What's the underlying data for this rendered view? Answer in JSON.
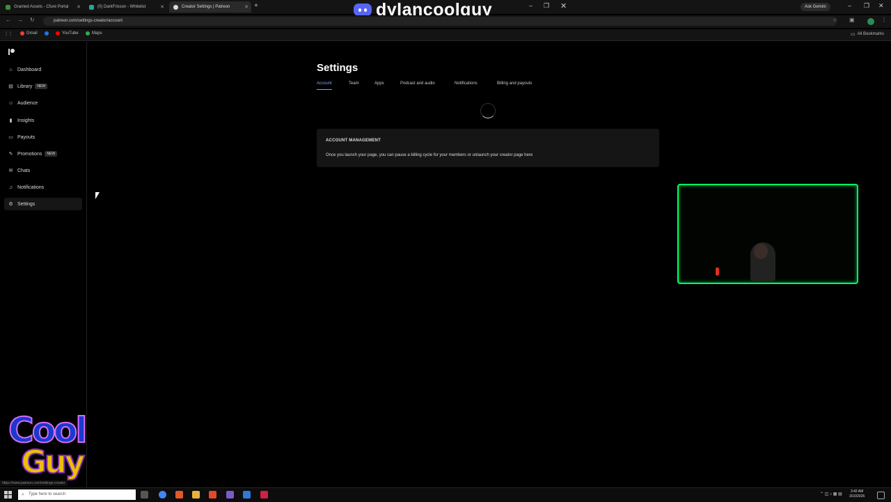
{
  "browser": {
    "tabs": [
      {
        "title": "Granted Assets - Cfure Portal",
        "color": "#3a8f3a"
      },
      {
        "title": "(0) DarkFrisson - Whitelist",
        "color": "#2aa39b"
      },
      {
        "title": "Creator Settings | Patreon",
        "color": "#dddddd"
      }
    ],
    "url": "patreon.com/settings-creator/account",
    "ask_gemini": "Ask Gemini",
    "bookmarks": [
      {
        "label": "Gmail",
        "color": "#ea4335"
      },
      {
        "label": "YouTube",
        "color": "#ff0000"
      },
      {
        "label": "Maps",
        "color": "#34a853"
      }
    ],
    "all_bookmarks": "All Bookmarks"
  },
  "overlay": {
    "discord_name": "dylancoolguy_",
    "logo_top": "Cool",
    "logo_bottom": "Guy"
  },
  "sidebar": {
    "items": [
      {
        "label": "Dashboard",
        "icon": "home-icon",
        "glyph": "⌂"
      },
      {
        "label": "Library",
        "icon": "library-icon",
        "glyph": "▤",
        "badge": "NEW"
      },
      {
        "label": "Audience",
        "icon": "audience-icon",
        "glyph": "☺"
      },
      {
        "label": "Insights",
        "icon": "insights-icon",
        "glyph": "▮"
      },
      {
        "label": "Payouts",
        "icon": "payouts-icon",
        "glyph": "▭"
      },
      {
        "label": "Promotions",
        "icon": "promotions-icon",
        "glyph": "✎",
        "badge": "NEW"
      },
      {
        "label": "Chats",
        "icon": "chats-icon",
        "glyph": "✉"
      },
      {
        "label": "Notifications",
        "icon": "bell-icon",
        "glyph": "♫"
      },
      {
        "label": "Settings",
        "icon": "gear-icon",
        "glyph": "⚙"
      }
    ]
  },
  "main": {
    "title": "Settings",
    "tabs": [
      "Account",
      "Team",
      "Apps",
      "Podcast and audio",
      "Notifications",
      "Billing and payouts"
    ],
    "card": {
      "heading": "ACCOUNT MANAGEMENT",
      "text": "Once you launch your page, you can pause a billing cycle for your members or unlaunch your creator page here"
    }
  },
  "taskbar": {
    "search_placeholder": "Type here to search",
    "time": "3:42 AM",
    "date": "3/10/2026",
    "app_colors": [
      "#4285f4",
      "#e05a2a",
      "#e8b33a",
      "#e04a2a",
      "#7a5cc8",
      "#2f7ad8",
      "#cc2244"
    ]
  },
  "status_bar_url": "https://www.patreon.com/settings-creator"
}
